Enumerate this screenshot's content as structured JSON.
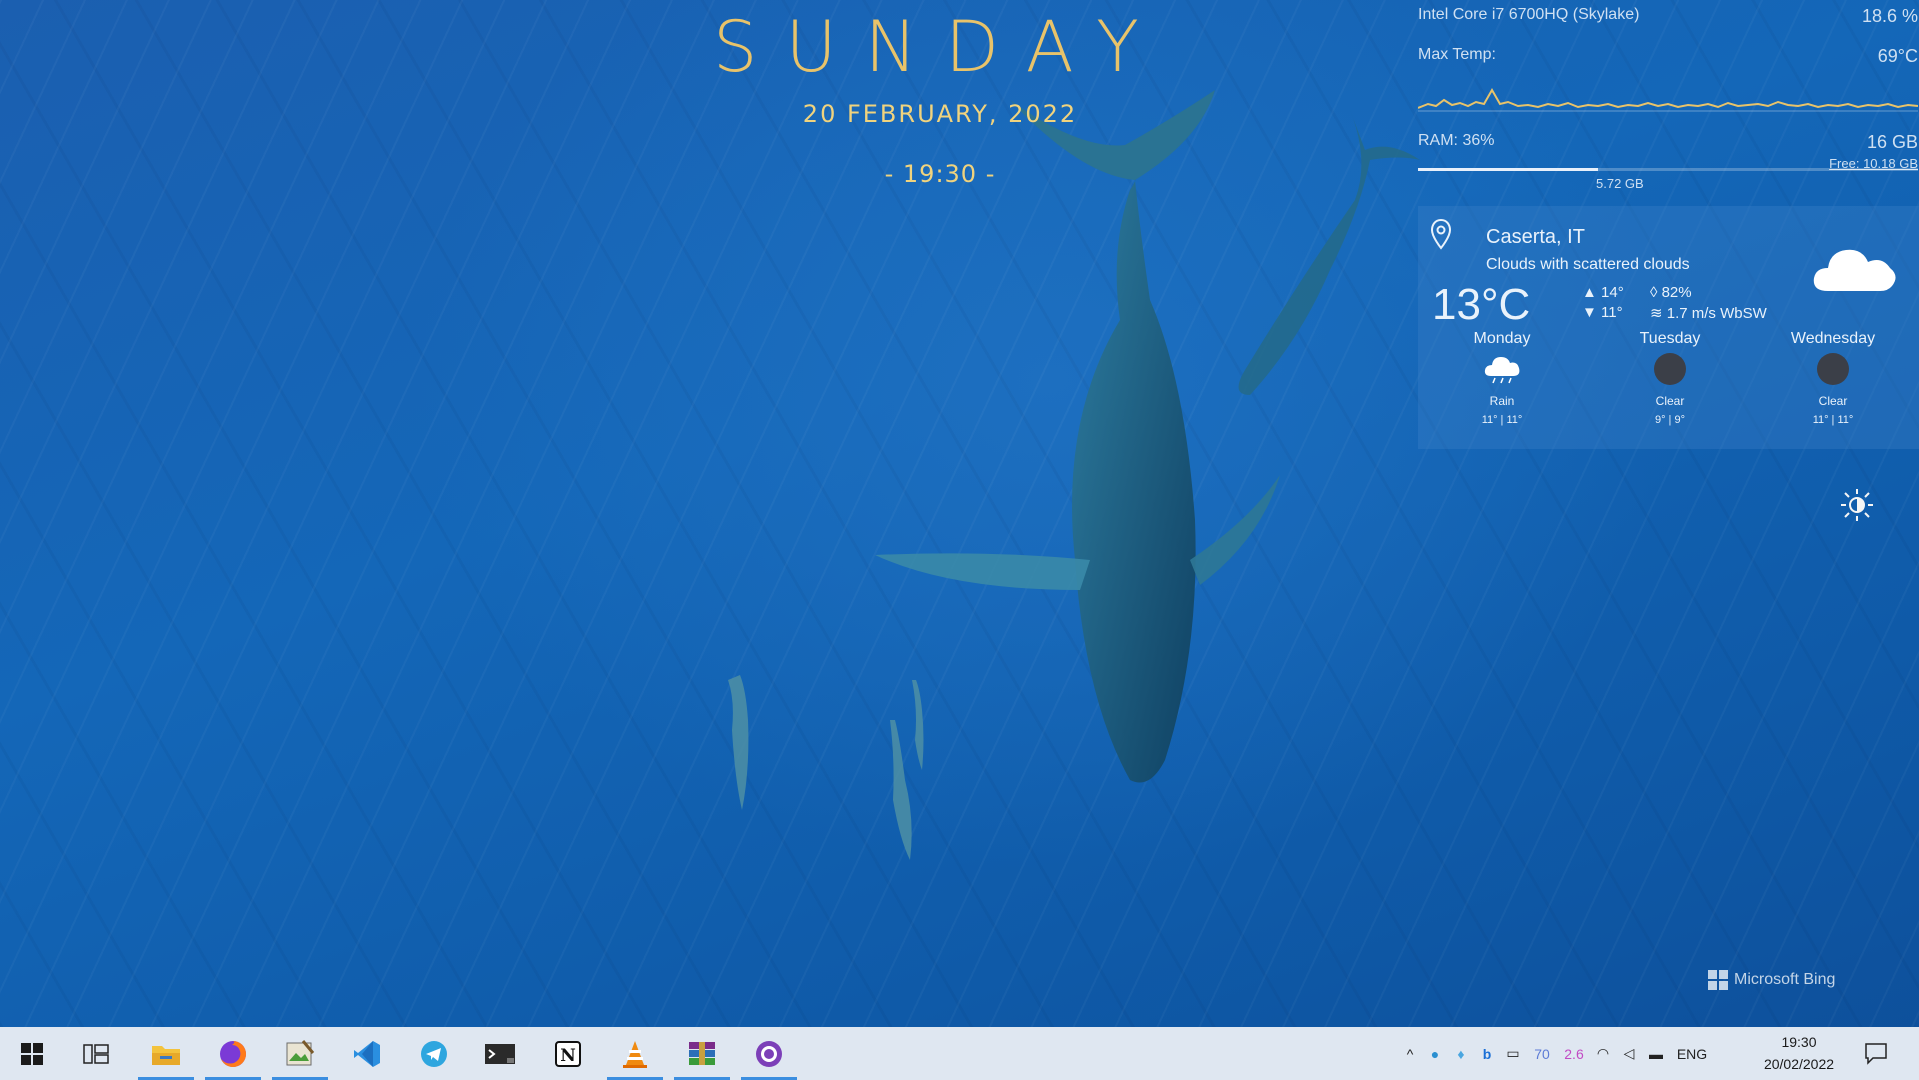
{
  "clock": {
    "day": "SUNDAY",
    "date": "20  FEBRUARY, 2022",
    "time": "- 19:30 -"
  },
  "monitor": {
    "cpu_name": "Intel Core i7 6700HQ (Skylake)",
    "cpu_usage": "18.6 %",
    "max_temp_label": "Max Temp:",
    "max_temp": "69°C",
    "ram_label": "RAM: 36%",
    "ram_total": "16 GB",
    "ram_free": "Free: 10.18 GB",
    "ram_used": "5.72 GB",
    "ram_fraction": 0.36
  },
  "weather": {
    "location": "Caserta, IT",
    "condition": "Clouds with scattered clouds",
    "temperature": "13°C",
    "high": "14°",
    "low": "11°",
    "humidity": "82%",
    "wind": "1.7 m/s WbSW",
    "forecast": [
      {
        "day": "Monday",
        "desc": "Rain",
        "range": "11° | 11°",
        "icon": "cloud-rain-icon"
      },
      {
        "day": "Tuesday",
        "desc": "Clear",
        "range": "9° | 9°",
        "icon": "moon-icon"
      },
      {
        "day": "Wednesday",
        "desc": "Clear",
        "range": "11° | 11°",
        "icon": "moon-icon"
      }
    ]
  },
  "watermark": "Microsoft Bing",
  "taskbar": {
    "apps": [
      "start-button",
      "task-view",
      "file-explorer",
      "firefox",
      "image-editor",
      "vscode",
      "telegram",
      "terminal",
      "notion",
      "vlc",
      "winrar",
      "github-desktop"
    ],
    "tray_numbers": [
      "70",
      "2.6"
    ],
    "language": "ENG",
    "time": "19:30",
    "date": "20/02/2022"
  },
  "colors": {
    "accent_gold": "#f0d37e",
    "taskbar_bg": "#dfe7f1",
    "active_indicator": "#3b8ee0"
  }
}
